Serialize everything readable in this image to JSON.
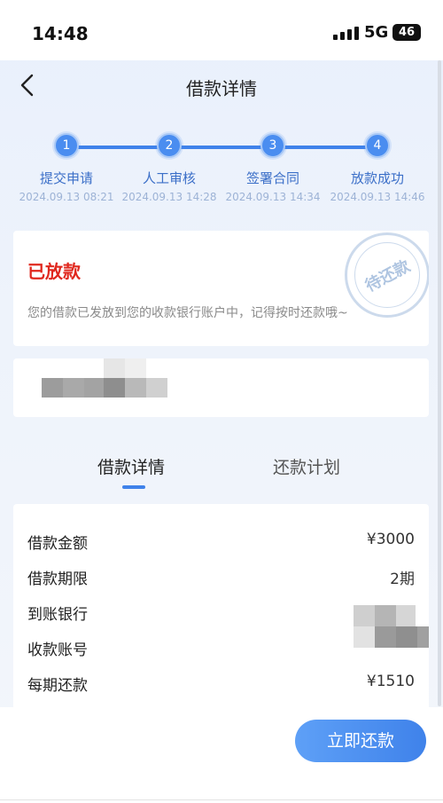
{
  "status_bar": {
    "time": "14:48",
    "network": "5G",
    "battery": "46"
  },
  "nav": {
    "title": "借款详情"
  },
  "steps": [
    {
      "index": "1",
      "label": "提交申请",
      "time": "2024.09.13 08:21"
    },
    {
      "index": "2",
      "label": "人工审核",
      "time": "2024.09.13 14:28"
    },
    {
      "index": "3",
      "label": "签署合同",
      "time": "2024.09.13 14:34"
    },
    {
      "index": "4",
      "label": "放款成功",
      "time": "2024.09.13 14:46"
    }
  ],
  "status_card": {
    "title": "已放款",
    "description": "您的借款已发放到您的收款银行账户中，记得按时还款哦~",
    "stamp": "待还款"
  },
  "tabs": [
    {
      "label": "借款详情"
    },
    {
      "label": "还款计划"
    }
  ],
  "details": [
    {
      "label": "借款金额",
      "value": "¥3000"
    },
    {
      "label": "借款期限",
      "value": "2期"
    },
    {
      "label": "到账银行",
      "value": ""
    },
    {
      "label": "收款账号",
      "value": ""
    },
    {
      "label": "每期还款",
      "value": "¥1510"
    }
  ],
  "bottom": {
    "repay_label": "立即还款"
  },
  "colors": {
    "accent": "#3f82ea",
    "danger": "#e0281e"
  }
}
